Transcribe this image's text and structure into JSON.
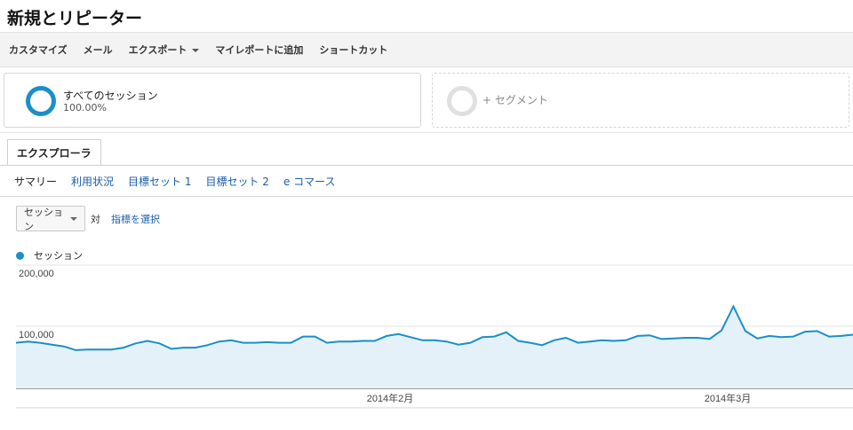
{
  "page": {
    "title": "新規とリピーター"
  },
  "toolbar": {
    "items": [
      {
        "label": "カスタマイズ"
      },
      {
        "label": "メール"
      },
      {
        "label": "エクスポート"
      },
      {
        "label": "マイレポートに追加"
      },
      {
        "label": "ショートカット"
      }
    ]
  },
  "segments": {
    "active": {
      "name": "すべてのセッション",
      "percent": "100.00%",
      "color": "#1a8fc9"
    },
    "add_label": "+ セグメント"
  },
  "explorer": {
    "tab_label": "エクスプローラ",
    "subtabs": [
      "サマリー",
      "利用状況",
      "目標セット 1",
      "目標セット 2",
      "e コマース"
    ]
  },
  "metric": {
    "selected": "セッション",
    "vs": "対",
    "pick_label": "指標を選択"
  },
  "chart_data": {
    "type": "area",
    "series": [
      {
        "name": "セッション",
        "color": "#1a8fc9",
        "values": [
          74000,
          76000,
          74000,
          71000,
          68000,
          62000,
          63000,
          63000,
          63000,
          66000,
          73000,
          77000,
          73000,
          64000,
          66000,
          66000,
          70000,
          76000,
          78000,
          74000,
          74000,
          75000,
          74000,
          74000,
          84000,
          84000,
          74000,
          76000,
          76000,
          77000,
          77000,
          85000,
          88000,
          83000,
          78000,
          78000,
          76000,
          71000,
          74000,
          83000,
          84000,
          91000,
          77000,
          74000,
          70000,
          78000,
          82000,
          74000,
          76000,
          78000,
          77000,
          78000,
          85000,
          86000,
          80000,
          81000,
          82000,
          82000,
          80000,
          94000,
          133000,
          93000,
          81000,
          85000,
          83000,
          84000,
          92000,
          93000,
          84000,
          85000,
          87000
        ]
      }
    ],
    "x_ticks": [
      "2014年2月",
      "2014年3月"
    ],
    "y_ticks": [
      "200,000",
      "100,000"
    ],
    "ylim": [
      0,
      200000
    ],
    "grid": true,
    "fill_color": "#e5f1f8"
  }
}
